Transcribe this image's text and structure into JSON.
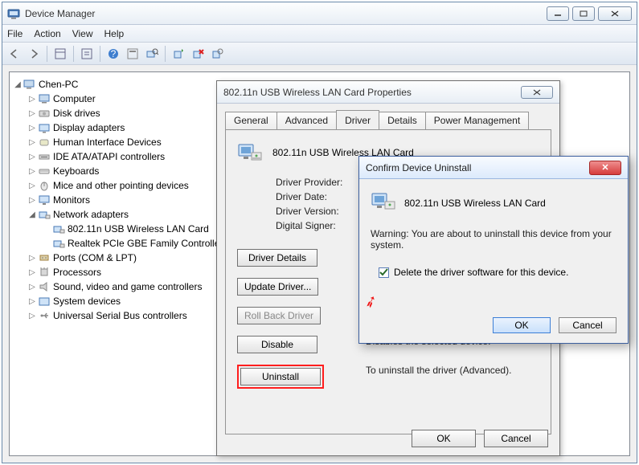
{
  "window": {
    "title": "Device Manager"
  },
  "menu": {
    "file": "File",
    "action": "Action",
    "view": "View",
    "help": "Help"
  },
  "tree": {
    "root": "Chen-PC",
    "items": [
      "Computer",
      "Disk drives",
      "Display adapters",
      "Human Interface Devices",
      "IDE ATA/ATAPI controllers",
      "Keyboards",
      "Mice and other pointing devices",
      "Monitors",
      "Network adapters",
      "Ports (COM & LPT)",
      "Processors",
      "Sound, video and game controllers",
      "System devices",
      "Universal Serial Bus controllers"
    ],
    "net_children": [
      "802.11n USB Wireless LAN Card",
      "Realtek PCIe GBE Family Controlle"
    ]
  },
  "props": {
    "title": "802.11n USB Wireless LAN Card Properties",
    "tabs": {
      "general": "General",
      "advanced": "Advanced",
      "driver": "Driver",
      "details": "Details",
      "power": "Power Management"
    },
    "dev_name": "802.11n USB Wireless LAN Card",
    "fields": {
      "provider": "Driver Provider:",
      "date": "Driver Date:",
      "version": "Driver Version:",
      "signer": "Digital Signer:"
    },
    "buttons": {
      "details": "Driver Details",
      "update": "Update Driver...",
      "rollback": "Roll Back Driver",
      "disable": "Disable",
      "uninstall": "Uninstall"
    },
    "desc": {
      "disable": "Disables the selected device.",
      "uninstall": "To uninstall the driver (Advanced)."
    },
    "foot": {
      "ok": "OK",
      "cancel": "Cancel"
    }
  },
  "confirm": {
    "title": "Confirm Device Uninstall",
    "dev": "802.11n USB Wireless LAN Card",
    "warn": "Warning: You are about to uninstall this device from your system.",
    "chk": "Delete the driver software for this device.",
    "ok": "OK",
    "cancel": "Cancel"
  }
}
